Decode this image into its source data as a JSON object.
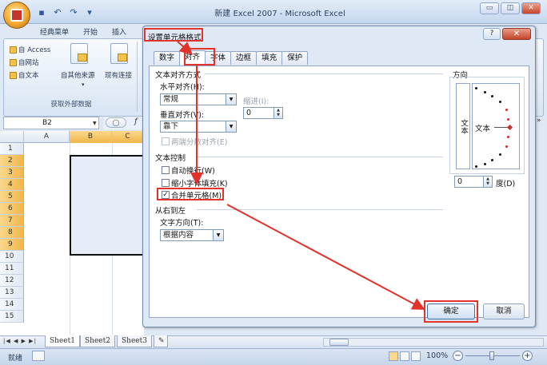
{
  "window": {
    "title": "新建 Excel 2007 - Microsoft Excel",
    "controls": [
      "▭",
      "◫",
      "✕"
    ]
  },
  "ribbon": {
    "tabs": [
      "经典菜单",
      "开始",
      "插入"
    ],
    "group_external": {
      "items": [
        "自 Access",
        "自网站",
        "自文本"
      ],
      "other_sources": "自其他来源",
      "existing": "现有连接",
      "label": "获取外部数据"
    }
  },
  "formula_bar": {
    "name_box": "B2",
    "fx": "f"
  },
  "grid": {
    "columns": [
      "",
      "A",
      "B",
      "C"
    ],
    "rows": [
      "1",
      "2",
      "3",
      "4",
      "5",
      "6",
      "7",
      "8",
      "9",
      "10",
      "11",
      "12",
      "13",
      "14",
      "15"
    ]
  },
  "sheets": [
    "Sheet1",
    "Sheet2",
    "Sheet3"
  ],
  "status": {
    "ready": "就绪",
    "zoom": "100%"
  },
  "dialog": {
    "title": "设置单元格格式",
    "help": "?",
    "close": "✕",
    "tabs": [
      "数字",
      "对齐",
      "字体",
      "边框",
      "填充",
      "保护"
    ],
    "alignment": {
      "section_title": "文本对齐方式",
      "horizontal_label": "水平对齐(H):",
      "horizontal_value": "常规",
      "indent_label": "缩进(I):",
      "indent_value": "0",
      "vertical_label": "垂直对齐(V):",
      "vertical_value": "靠下",
      "justify_distributed": "两端分散对齐(E)"
    },
    "text_control": {
      "section_title": "文本控制",
      "wrap": "自动换行(W)",
      "shrink": "缩小字体填充(K)",
      "merge": "合并单元格(M)",
      "merge_checked": true
    },
    "rtl": {
      "section_title": "从右到左",
      "direction_label": "文字方向(T):",
      "direction_value": "根据内容"
    },
    "orientation": {
      "title": "方向",
      "vertical_text": "文本",
      "dial_text": "文本",
      "degree_value": "0",
      "degree_label": "度(D)"
    },
    "ok": "确定",
    "cancel": "取消"
  },
  "colors": {
    "highlight": "#e1322b",
    "selection_header": "#f1b64b"
  }
}
